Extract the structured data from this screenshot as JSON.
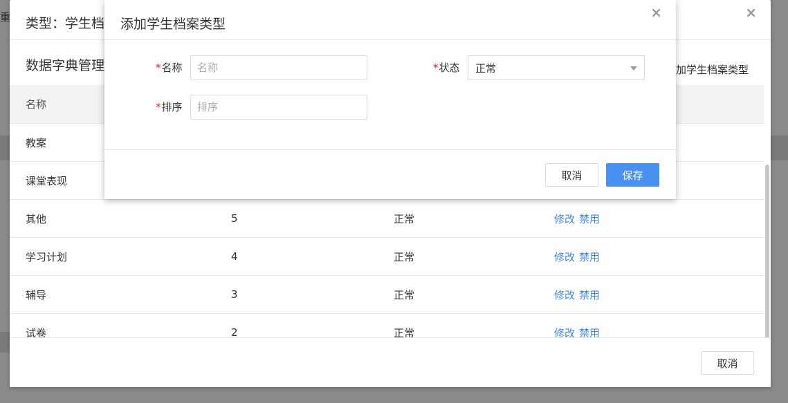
{
  "background": {
    "edge_text": "重"
  },
  "outer_dialog": {
    "title": "类型：学生档",
    "close": "×",
    "subtitle": "数据字典管理",
    "add_link": "加学生档案类型",
    "table": {
      "headers": [
        "名称"
      ],
      "rows": [
        {
          "name": "教案",
          "sort": "",
          "status": "",
          "actions": []
        },
        {
          "name": "课堂表现",
          "sort": "",
          "status": "",
          "actions": []
        },
        {
          "name": "其他",
          "sort": "5",
          "status": "正常",
          "actions": [
            "修改",
            "禁用"
          ]
        },
        {
          "name": "学习计划",
          "sort": "4",
          "status": "正常",
          "actions": [
            "修改",
            "禁用"
          ]
        },
        {
          "name": "辅导",
          "sort": "3",
          "status": "正常",
          "actions": [
            "修改",
            "禁用"
          ]
        },
        {
          "name": "试卷",
          "sort": "2",
          "status": "正常",
          "actions": [
            "修改",
            "禁用"
          ]
        }
      ]
    },
    "cancel_label": "取消"
  },
  "modal": {
    "title": "添加学生档案类型",
    "close": "×",
    "required_mark": "*",
    "name_label": "名称",
    "name_placeholder": "名称",
    "status_label": "状态",
    "status_value": "正常",
    "sort_label": "排序",
    "sort_placeholder": "排序",
    "cancel_label": "取消",
    "save_label": "保存"
  },
  "colors": {
    "primary": "#4a90f0",
    "link": "#3f86e5",
    "required": "#e02020"
  }
}
